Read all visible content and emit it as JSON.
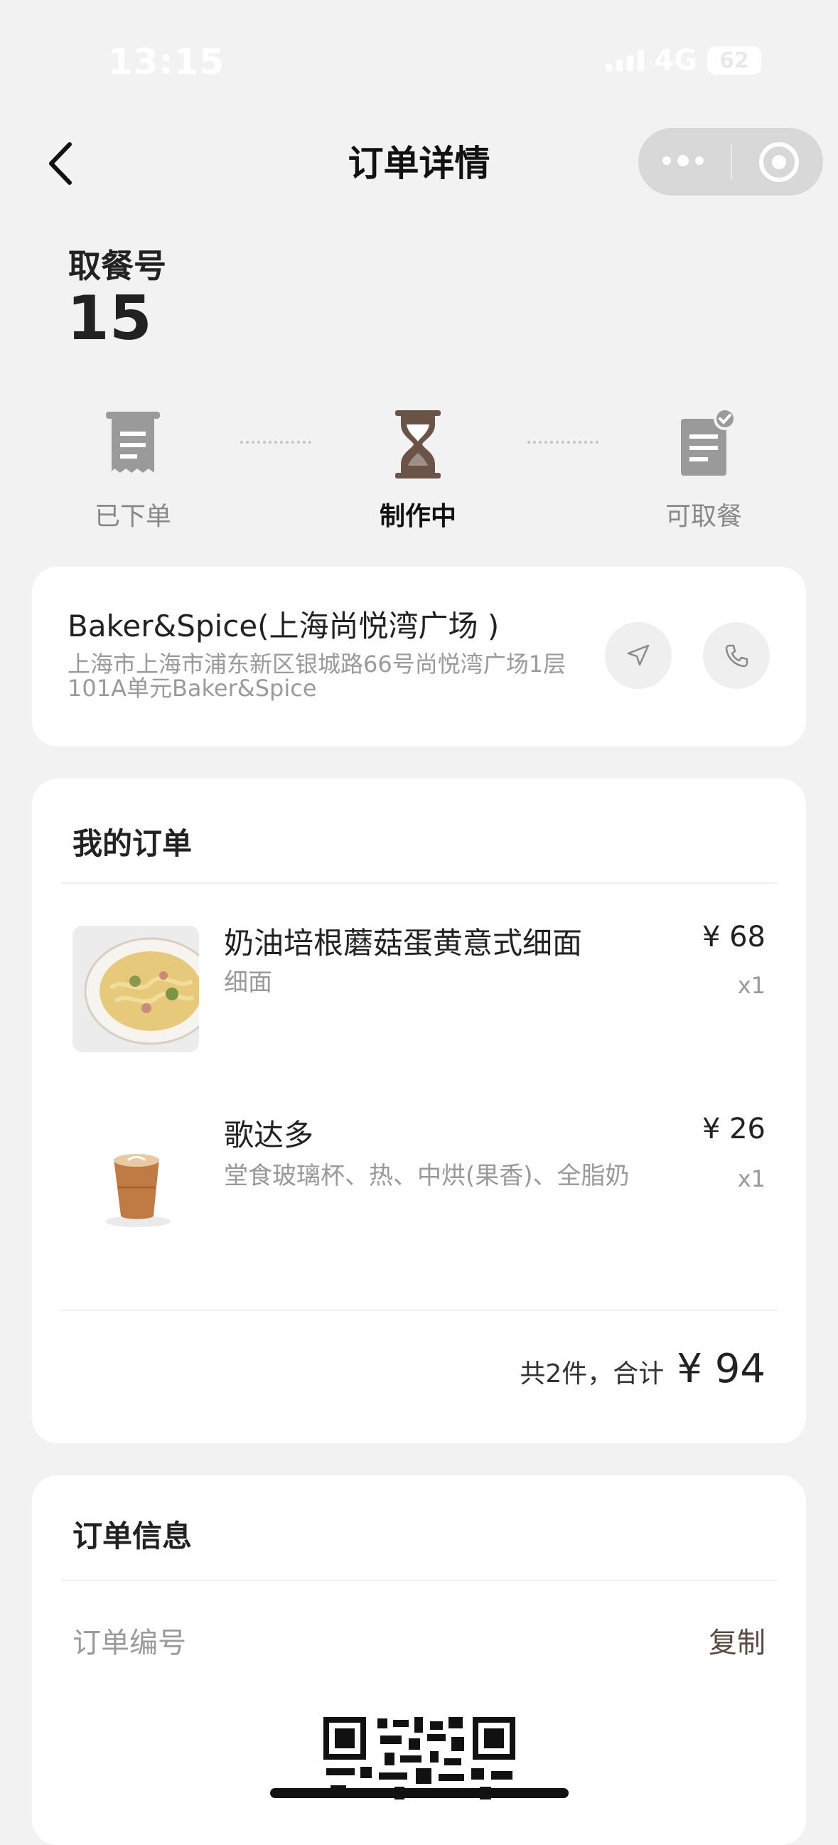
{
  "status_bar": {
    "time": "13:15",
    "network": "4G",
    "battery": "62"
  },
  "nav": {
    "title": "订单详情"
  },
  "pickup": {
    "label": "取餐号",
    "number": "15"
  },
  "progress": {
    "steps": [
      {
        "label": "已下单",
        "icon": "receipt-icon",
        "active": false
      },
      {
        "label": "制作中",
        "icon": "hourglass-icon",
        "active": true
      },
      {
        "label": "可取餐",
        "icon": "clipboard-check-icon",
        "active": false
      }
    ]
  },
  "store": {
    "name": "Baker&Spice(上海尚悦湾广场 )",
    "address": "上海市上海市浦东新区银城路66号尚悦湾广场1层101A单元Baker&Spice"
  },
  "order": {
    "title": "我的订单",
    "items": [
      {
        "name": "奶油培根蘑菇蛋黄意式细面",
        "options": "细面",
        "price": "¥ 68",
        "qty": "x1"
      },
      {
        "name": "歌达多",
        "options": "堂食玻璃杯、热、中烘(果香)、全脂奶",
        "price": "¥ 26",
        "qty": "x1"
      }
    ],
    "total_label": "共2件，合计",
    "total_value": "¥ 94"
  },
  "order_info": {
    "title": "订单信息",
    "number_label": "订单编号",
    "copy_label": "复制"
  },
  "colors": {
    "background": "#f2f2f2",
    "accent_brown": "#5b4a3f",
    "active_step": "#6b5347",
    "inactive_step": "#9a9a9a"
  }
}
